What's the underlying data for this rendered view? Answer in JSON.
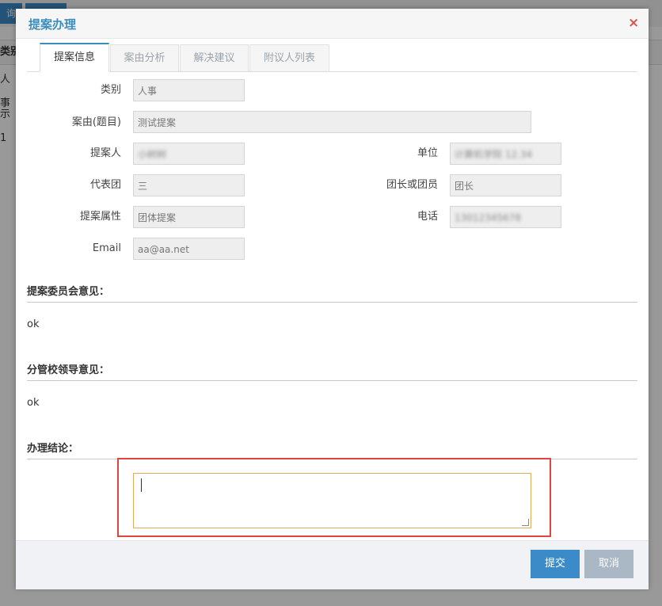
{
  "background": {
    "toolbar_btn": "询",
    "table_header_cell": "类别",
    "table_cell": "人事",
    "pagination_text": "示 1"
  },
  "modal": {
    "title": "提案办理",
    "close_symbol": "×",
    "tabs": [
      "提案信息",
      "案由分析",
      "解决建议",
      "附议人列表"
    ],
    "active_tab": 0,
    "fields": {
      "category": {
        "label": "类别",
        "value": "人事"
      },
      "subject": {
        "label": "案由(题目)",
        "value": "测试提案"
      },
      "proposer": {
        "label": "提案人",
        "value": "小树树"
      },
      "unit": {
        "label": "单位",
        "value": "计算机学院 12.34"
      },
      "delegation": {
        "label": "代表团",
        "value": "三"
      },
      "role": {
        "label": "团长或团员",
        "value": "团长"
      },
      "proposal_type": {
        "label": "提案属性",
        "value": "团体提案"
      },
      "phone": {
        "label": "电话",
        "value": "13012345678"
      },
      "email": {
        "label": "Email",
        "value": "aa@aa.net"
      }
    },
    "committee_opinion": {
      "title": "提案委员会意见：",
      "text": "ok"
    },
    "leader_opinion": {
      "title": "分管校领导意见：",
      "text": "ok"
    },
    "conclusion": {
      "title": "办理结论：",
      "value": ""
    },
    "buttons": {
      "submit": "提交",
      "cancel": "取消"
    }
  },
  "colors": {
    "accent": "#3b8bc9",
    "highlight_border": "#e0443f",
    "close": "#d9534f"
  }
}
